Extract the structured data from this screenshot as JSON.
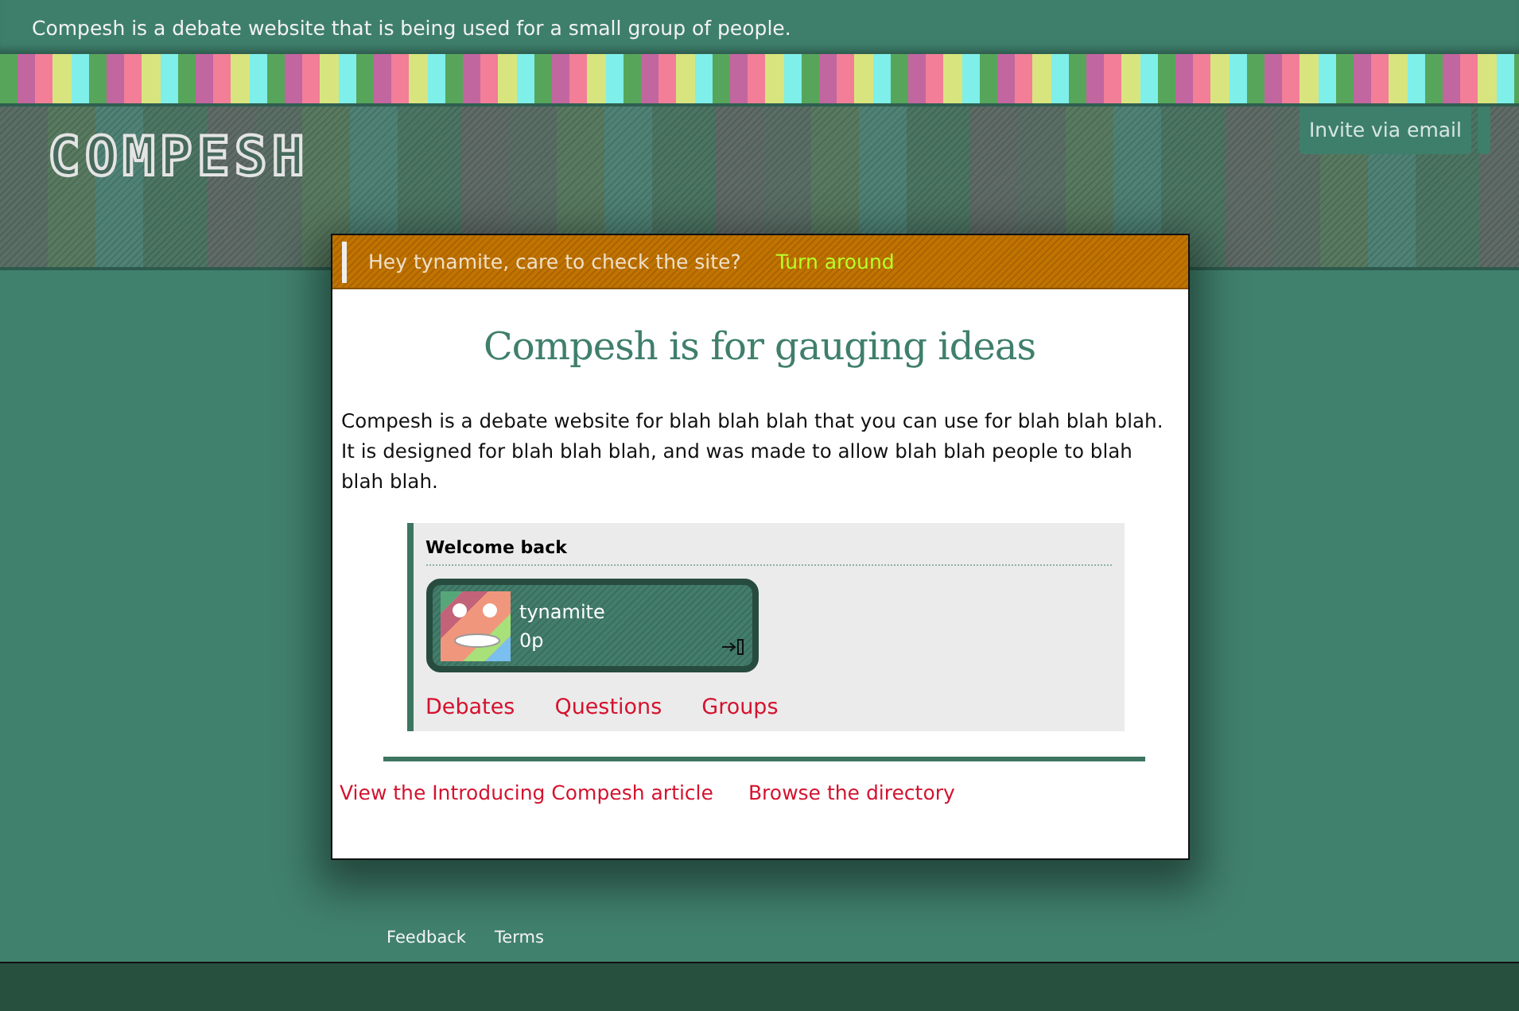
{
  "top_bar": {
    "text": "Compesh is a debate website that is being used for a small group of people."
  },
  "header": {
    "logo": "COMPESH",
    "invite_button": "Invite via email"
  },
  "notice": {
    "text": "Hey tynamite, care to check the site?",
    "link": "Turn around"
  },
  "main": {
    "title": "Compesh is for gauging ideas",
    "intro": "Compesh is a debate website for blah blah blah that you can use for blah blah blah. It is designed for blah blah blah, and was made to allow blah blah people to blah blah blah.",
    "welcome": {
      "heading": "Welcome back",
      "user": {
        "name": "tynamite",
        "points": "0p"
      },
      "links": [
        "Debates",
        "Questions",
        "Groups"
      ]
    },
    "bottom_links": [
      "View the Introducing Compesh article",
      "Browse the directory"
    ]
  },
  "footer": {
    "links": [
      "Feedback",
      "Terms"
    ]
  }
}
